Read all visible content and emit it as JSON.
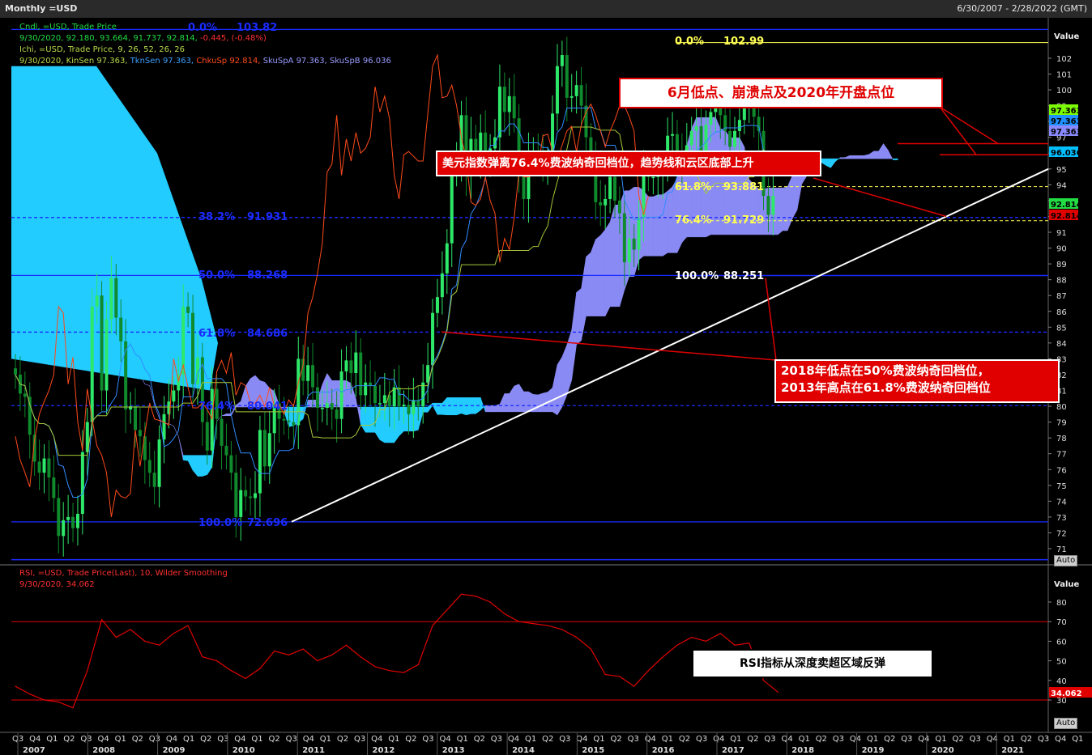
{
  "window": {
    "title": "Monthly =USD",
    "date_range": "6/30/2007 - 2/28/2022 (GMT)"
  },
  "legend": {
    "cndl_title": "Cndl, =USD, Trade Price",
    "cndl_values": "9/30/2020, 92.180, 93.664, 91.737, 92.814,",
    "cndl_change": "-0.445, (-0.48%)",
    "ichi_title": "Ichi, =USD, Trade Price,  9, 26, 52, 26, 26",
    "ichi_date": "9/30/2020,",
    "kinsen": "KinSen 97.363,",
    "tknsen": "TknSen 97.363,",
    "chkusp": "ChkuSp 92.814,",
    "skuspa": "SkuSpA 97.363,",
    "skuspb": "SkuSpB 96.036",
    "rsi_title": "RSI, =USD, Trade Price(Last),  10, Wilder Smoothing",
    "rsi_value": "9/30/2020, 34.062"
  },
  "axis": {
    "value_label": "Value",
    "rsi_value_label": "Value",
    "auto_label": "Auto",
    "auto_label_rsi": "Auto",
    "price_ticks": [
      "102",
      "101",
      "100",
      "99",
      "98",
      "97",
      "96",
      "95",
      "94",
      "93",
      "92",
      "91",
      "90",
      "89",
      "88",
      "87",
      "86",
      "85",
      "84",
      "83",
      "82",
      "81",
      "80",
      "79",
      "78",
      "77",
      "76",
      "75",
      "74",
      "73",
      "72",
      "71"
    ],
    "rsi_ticks": [
      "80",
      "70",
      "60",
      "50",
      "40",
      "30"
    ],
    "price_tags": [
      {
        "text": "97.363",
        "color": "#7CFC00"
      },
      {
        "text": "97.363",
        "color": "#1E90FF"
      },
      {
        "text": "97.363",
        "color": "#8A8AFF"
      },
      {
        "text": "96.036",
        "color": "#00BFFF"
      },
      {
        "text": "92.814",
        "color": "#22DD44"
      },
      {
        "text": "92.814",
        "color": "#E00000"
      }
    ],
    "rsi_tag": "34.062",
    "x_quarters": [
      "Q3",
      "Q4",
      "Q1",
      "Q2",
      "Q3",
      "Q4",
      "Q1",
      "Q2",
      "Q3",
      "Q4",
      "Q1",
      "Q2",
      "Q3",
      "Q4",
      "Q1",
      "Q2",
      "Q3",
      "Q4",
      "Q1",
      "Q2",
      "Q3",
      "Q4",
      "Q1",
      "Q2",
      "Q3",
      "Q4",
      "Q1",
      "Q2",
      "Q3",
      "Q4",
      "Q1",
      "Q2",
      "Q3",
      "Q4",
      "Q1",
      "Q2",
      "Q3",
      "Q4",
      "Q1",
      "Q2",
      "Q3",
      "Q4",
      "Q1",
      "Q2",
      "Q3",
      "Q4",
      "Q1",
      "Q2",
      "Q3",
      "Q4",
      "Q1",
      "Q2",
      "Q3",
      "Q4",
      "Q1",
      "Q2",
      "Q3",
      "Q4",
      "Q1",
      "Q2",
      "Q3",
      "Q4",
      "Q1"
    ],
    "x_years": [
      "2007",
      "2008",
      "2009",
      "2010",
      "2011",
      "2012",
      "2013",
      "2014",
      "2015",
      "2016",
      "2017",
      "2018",
      "2019",
      "2020",
      "2021"
    ]
  },
  "fib_left": [
    {
      "pct": "0.0%",
      "value": "103.82"
    },
    {
      "pct": "38.2%",
      "value": "91.931"
    },
    {
      "pct": "50.0%",
      "value": "88.268"
    },
    {
      "pct": "61.8%",
      "value": "84.686"
    },
    {
      "pct": "76.4%",
      "value": "80.041"
    },
    {
      "pct": "100.0%",
      "value": "72.696"
    }
  ],
  "fib_right": [
    {
      "pct": "0.0%",
      "value": "102.99"
    },
    {
      "pct": "61.8%",
      "value": "93.881"
    },
    {
      "pct": "76.4%",
      "value": "91.729"
    },
    {
      "pct": "100.0%",
      "value": "88.251"
    }
  ],
  "annotations": {
    "top": "6月低点、崩溃点及2020年开盘点位",
    "mid": "美元指数弹离76.4%费波纳奇回档位，趋势线和云区底部上升",
    "low_line1": "2018年低点在50%费波纳奇回档位，",
    "low_line2": "2013年高点在61.8%费波纳奇回档位",
    "rsi": "RSI指标从深度卖超区域反弹"
  },
  "chart_data": [
    {
      "type": "candlestick",
      "title": "Monthly =USD",
      "ylabel": "Value",
      "ylim": [
        70.5,
        104
      ],
      "x": [
        "2007-06",
        "2007-07",
        "2007-08",
        "2007-09",
        "2007-10",
        "2007-11",
        "2007-12",
        "2008-01",
        "2008-02",
        "2008-03",
        "2008-04",
        "2008-05",
        "2008-06",
        "2008-07",
        "2008-08",
        "2008-09",
        "2008-10",
        "2008-11",
        "2008-12",
        "2009-01",
        "2009-02",
        "2009-03",
        "2009-04",
        "2009-05",
        "2009-06",
        "2009-07",
        "2009-08",
        "2009-09",
        "2009-10",
        "2009-11",
        "2009-12",
        "2010-01",
        "2010-02",
        "2010-03",
        "2010-04",
        "2010-05",
        "2010-06",
        "2010-07",
        "2010-08",
        "2010-09",
        "2010-10",
        "2010-11",
        "2010-12",
        "2011-01",
        "2011-02",
        "2011-03",
        "2011-04",
        "2011-05",
        "2011-06",
        "2011-07",
        "2011-08",
        "2011-09",
        "2011-10",
        "2011-11",
        "2011-12",
        "2012-01",
        "2012-02",
        "2012-03",
        "2012-04",
        "2012-05",
        "2012-06",
        "2012-07",
        "2012-08",
        "2012-09",
        "2012-10",
        "2012-11",
        "2012-12",
        "2013-01",
        "2013-02",
        "2013-03",
        "2013-04",
        "2013-05",
        "2013-06",
        "2013-07",
        "2013-08",
        "2013-09",
        "2013-10",
        "2013-11",
        "2013-12",
        "2014-01",
        "2014-02",
        "2014-03",
        "2014-04",
        "2014-05",
        "2014-06",
        "2014-07",
        "2014-08",
        "2014-09",
        "2014-10",
        "2014-11",
        "2014-12",
        "2015-01",
        "2015-02",
        "2015-03",
        "2015-04",
        "2015-05",
        "2015-06",
        "2015-07",
        "2015-08",
        "2015-09",
        "2015-10",
        "2015-11",
        "2015-12",
        "2016-01",
        "2016-02",
        "2016-03",
        "2016-04",
        "2016-05",
        "2016-06",
        "2016-07",
        "2016-08",
        "2016-09",
        "2016-10",
        "2016-11",
        "2016-12",
        "2017-01",
        "2017-02",
        "2017-03",
        "2017-04",
        "2017-05",
        "2017-06",
        "2017-07",
        "2017-08",
        "2017-09",
        "2017-10",
        "2017-11",
        "2017-12",
        "2018-01",
        "2018-02",
        "2018-03",
        "2018-04",
        "2018-05",
        "2018-06",
        "2018-07",
        "2018-08",
        "2018-09",
        "2018-10",
        "2018-11",
        "2018-12",
        "2019-01",
        "2019-02",
        "2019-03",
        "2019-04",
        "2019-05",
        "2019-06",
        "2019-07",
        "2019-08",
        "2019-09",
        "2019-10",
        "2019-11",
        "2019-12",
        "2020-01",
        "2020-02",
        "2020-03",
        "2020-04",
        "2020-05",
        "2020-06",
        "2020-07",
        "2020-08",
        "2020-09"
      ],
      "close": [
        82.0,
        80.8,
        80.6,
        78.2,
        76.5,
        75.8,
        76.7,
        75.5,
        74.2,
        71.8,
        72.8,
        73.0,
        72.3,
        73.2,
        77.1,
        79.0,
        86.3,
        87.0,
        81.0,
        85.5,
        88.1,
        85.6,
        84.1,
        79.8,
        80.0,
        78.5,
        78.1,
        76.6,
        75.8,
        74.9,
        77.9,
        79.5,
        80.3,
        81.0,
        82.0,
        86.3,
        85.9,
        81.4,
        83.1,
        79.0,
        77.2,
        81.1,
        79.2,
        77.5,
        76.9,
        75.8,
        73.0,
        74.7,
        74.3,
        74.2,
        74.5,
        78.5,
        76.2,
        78.3,
        80.2,
        79.2,
        79.1,
        79.0,
        78.8,
        83.0,
        81.6,
        82.6,
        81.2,
        79.9,
        79.9,
        80.2,
        79.8,
        79.2,
        82.2,
        82.9,
        82.1,
        83.4,
        80.7,
        81.5,
        81.3,
        80.2,
        80.2,
        80.7,
        80.0,
        81.2,
        80.0,
        80.1,
        79.5,
        80.4,
        80.0,
        81.5,
        82.6,
        85.9,
        86.9,
        88.4,
        90.3,
        94.8,
        95.3,
        98.4,
        94.6,
        96.9,
        95.5,
        97.3,
        96.0,
        96.3,
        97.0,
        100.2,
        98.6,
        99.6,
        98.2,
        94.6,
        93.1,
        95.9,
        96.1,
        95.8,
        95.5,
        95.5,
        98.5,
        101.5,
        102.2,
        99.5,
        99.6,
        100.3,
        99.0,
        97.0,
        95.6,
        92.9,
        92.7,
        93.1,
        94.5,
        93.0,
        92.2,
        89.1,
        90.6,
        89.9,
        91.9,
        94.8,
        94.5,
        94.5,
        94.6,
        95.1,
        97.1,
        97.2,
        96.1,
        95.6,
        96.5,
        97.4,
        97.7,
        96.1,
        97.8,
        98.6,
        99.1,
        98.4,
        97.4,
        96.4,
        97.4,
        98.1,
        99.0,
        99.0,
        98.3,
        97.4,
        93.3,
        92.1,
        93.3
      ],
      "annotations_printed": [
        "0.0% 103.82",
        "38.2% 91.931",
        "50.0% 88.268",
        "61.8% 84.686",
        "76.4% 80.041",
        "100.0% 72.696",
        "0.0% 102.99",
        "61.8% 93.881",
        "76.4% 91.729",
        "100.0% 88.251"
      ]
    },
    {
      "type": "line",
      "title": "RSI, =USD, Trade Price(Last),  10, Wilder Smoothing",
      "ylabel": "Value",
      "ylim": [
        25,
        90
      ],
      "reference_lines": [
        70,
        30
      ],
      "x": [
        "2007-06",
        "2007-09",
        "2007-12",
        "2008-03",
        "2008-06",
        "2008-09",
        "2008-12",
        "2009-03",
        "2009-06",
        "2009-09",
        "2009-12",
        "2010-03",
        "2010-06",
        "2010-09",
        "2010-12",
        "2011-03",
        "2011-06",
        "2011-09",
        "2011-12",
        "2012-03",
        "2012-06",
        "2012-09",
        "2012-12",
        "2013-03",
        "2013-06",
        "2013-09",
        "2013-12",
        "2014-03",
        "2014-06",
        "2014-09",
        "2014-12",
        "2015-03",
        "2015-06",
        "2015-09",
        "2015-12",
        "2016-03",
        "2016-06",
        "2016-09",
        "2016-12",
        "2017-03",
        "2017-06",
        "2017-09",
        "2017-12",
        "2018-03",
        "2018-06",
        "2018-09",
        "2018-12",
        "2019-03",
        "2019-06",
        "2019-09",
        "2019-12",
        "2020-03",
        "2020-06",
        "2020-09"
      ],
      "values": [
        37,
        33,
        30,
        29,
        26,
        45,
        71,
        62,
        66,
        60,
        58,
        64,
        68,
        52,
        50,
        45,
        41,
        46,
        55,
        53,
        56,
        50,
        53,
        58,
        52,
        47,
        45,
        44,
        48,
        68,
        76,
        84,
        83,
        80,
        74,
        70,
        69,
        68,
        66,
        62,
        56,
        43,
        42,
        37,
        45,
        52,
        58,
        62,
        60,
        64,
        58,
        59,
        40,
        34
      ]
    }
  ]
}
